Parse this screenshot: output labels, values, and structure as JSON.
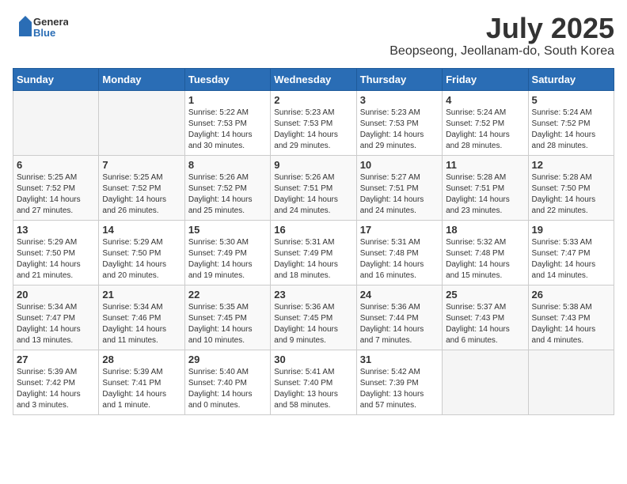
{
  "logo": {
    "text_general": "General",
    "text_blue": "Blue"
  },
  "title": "July 2025",
  "location": "Beopseong, Jeollanam-do, South Korea",
  "days_of_week": [
    "Sunday",
    "Monday",
    "Tuesday",
    "Wednesday",
    "Thursday",
    "Friday",
    "Saturday"
  ],
  "weeks": [
    [
      {
        "day": "",
        "info": ""
      },
      {
        "day": "",
        "info": ""
      },
      {
        "day": "1",
        "info": "Sunrise: 5:22 AM\nSunset: 7:53 PM\nDaylight: 14 hours\nand 30 minutes."
      },
      {
        "day": "2",
        "info": "Sunrise: 5:23 AM\nSunset: 7:53 PM\nDaylight: 14 hours\nand 29 minutes."
      },
      {
        "day": "3",
        "info": "Sunrise: 5:23 AM\nSunset: 7:53 PM\nDaylight: 14 hours\nand 29 minutes."
      },
      {
        "day": "4",
        "info": "Sunrise: 5:24 AM\nSunset: 7:52 PM\nDaylight: 14 hours\nand 28 minutes."
      },
      {
        "day": "5",
        "info": "Sunrise: 5:24 AM\nSunset: 7:52 PM\nDaylight: 14 hours\nand 28 minutes."
      }
    ],
    [
      {
        "day": "6",
        "info": "Sunrise: 5:25 AM\nSunset: 7:52 PM\nDaylight: 14 hours\nand 27 minutes."
      },
      {
        "day": "7",
        "info": "Sunrise: 5:25 AM\nSunset: 7:52 PM\nDaylight: 14 hours\nand 26 minutes."
      },
      {
        "day": "8",
        "info": "Sunrise: 5:26 AM\nSunset: 7:52 PM\nDaylight: 14 hours\nand 25 minutes."
      },
      {
        "day": "9",
        "info": "Sunrise: 5:26 AM\nSunset: 7:51 PM\nDaylight: 14 hours\nand 24 minutes."
      },
      {
        "day": "10",
        "info": "Sunrise: 5:27 AM\nSunset: 7:51 PM\nDaylight: 14 hours\nand 24 minutes."
      },
      {
        "day": "11",
        "info": "Sunrise: 5:28 AM\nSunset: 7:51 PM\nDaylight: 14 hours\nand 23 minutes."
      },
      {
        "day": "12",
        "info": "Sunrise: 5:28 AM\nSunset: 7:50 PM\nDaylight: 14 hours\nand 22 minutes."
      }
    ],
    [
      {
        "day": "13",
        "info": "Sunrise: 5:29 AM\nSunset: 7:50 PM\nDaylight: 14 hours\nand 21 minutes."
      },
      {
        "day": "14",
        "info": "Sunrise: 5:29 AM\nSunset: 7:50 PM\nDaylight: 14 hours\nand 20 minutes."
      },
      {
        "day": "15",
        "info": "Sunrise: 5:30 AM\nSunset: 7:49 PM\nDaylight: 14 hours\nand 19 minutes."
      },
      {
        "day": "16",
        "info": "Sunrise: 5:31 AM\nSunset: 7:49 PM\nDaylight: 14 hours\nand 18 minutes."
      },
      {
        "day": "17",
        "info": "Sunrise: 5:31 AM\nSunset: 7:48 PM\nDaylight: 14 hours\nand 16 minutes."
      },
      {
        "day": "18",
        "info": "Sunrise: 5:32 AM\nSunset: 7:48 PM\nDaylight: 14 hours\nand 15 minutes."
      },
      {
        "day": "19",
        "info": "Sunrise: 5:33 AM\nSunset: 7:47 PM\nDaylight: 14 hours\nand 14 minutes."
      }
    ],
    [
      {
        "day": "20",
        "info": "Sunrise: 5:34 AM\nSunset: 7:47 PM\nDaylight: 14 hours\nand 13 minutes."
      },
      {
        "day": "21",
        "info": "Sunrise: 5:34 AM\nSunset: 7:46 PM\nDaylight: 14 hours\nand 11 minutes."
      },
      {
        "day": "22",
        "info": "Sunrise: 5:35 AM\nSunset: 7:45 PM\nDaylight: 14 hours\nand 10 minutes."
      },
      {
        "day": "23",
        "info": "Sunrise: 5:36 AM\nSunset: 7:45 PM\nDaylight: 14 hours\nand 9 minutes."
      },
      {
        "day": "24",
        "info": "Sunrise: 5:36 AM\nSunset: 7:44 PM\nDaylight: 14 hours\nand 7 minutes."
      },
      {
        "day": "25",
        "info": "Sunrise: 5:37 AM\nSunset: 7:43 PM\nDaylight: 14 hours\nand 6 minutes."
      },
      {
        "day": "26",
        "info": "Sunrise: 5:38 AM\nSunset: 7:43 PM\nDaylight: 14 hours\nand 4 minutes."
      }
    ],
    [
      {
        "day": "27",
        "info": "Sunrise: 5:39 AM\nSunset: 7:42 PM\nDaylight: 14 hours\nand 3 minutes."
      },
      {
        "day": "28",
        "info": "Sunrise: 5:39 AM\nSunset: 7:41 PM\nDaylight: 14 hours\nand 1 minute."
      },
      {
        "day": "29",
        "info": "Sunrise: 5:40 AM\nSunset: 7:40 PM\nDaylight: 14 hours\nand 0 minutes."
      },
      {
        "day": "30",
        "info": "Sunrise: 5:41 AM\nSunset: 7:40 PM\nDaylight: 13 hours\nand 58 minutes."
      },
      {
        "day": "31",
        "info": "Sunrise: 5:42 AM\nSunset: 7:39 PM\nDaylight: 13 hours\nand 57 minutes."
      },
      {
        "day": "",
        "info": ""
      },
      {
        "day": "",
        "info": ""
      }
    ]
  ]
}
